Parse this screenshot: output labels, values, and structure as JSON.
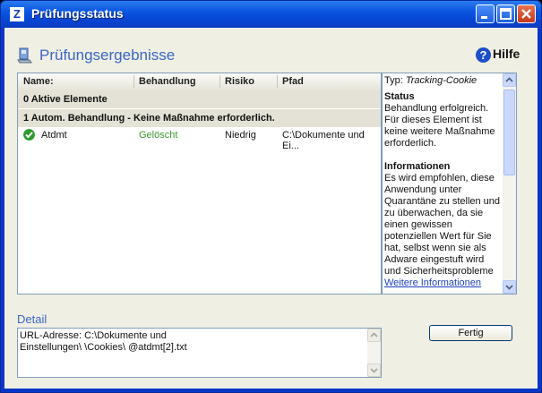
{
  "window": {
    "title": "Prüfungsstatus"
  },
  "header": {
    "title": "Prüfungsergebnisse",
    "help_label": "Hilfe"
  },
  "list": {
    "columns": [
      "Name:",
      "Behandlung",
      "Risiko",
      "Pfad"
    ],
    "groups": [
      {
        "label": "0 Aktive Elemente"
      },
      {
        "label": "1 Autom. Behandlung - Keine Maßnahme erforderlich."
      }
    ],
    "rows": [
      {
        "name": "Atdmt",
        "treatment": "Gelöscht",
        "risk": "Niedrig",
        "path": "C:\\Dokumente und Ei..."
      }
    ],
    "treatment_color": "#3a9a2a"
  },
  "info": {
    "type_label": "Typ:",
    "type_value": "Tracking-Cookie",
    "status_heading": "Status",
    "status_text": "Behandlung erfolgreich. Für dieses Element ist keine weitere Maßnahme erforderlich.",
    "info_heading": "Informationen",
    "info_text": "Es wird empfohlen, diese Anwendung unter Quarantäne zu stellen und zu überwachen, da sie einen gewissen potenziellen Wert für Sie hat, selbst wenn sie als Adware eingestuft wird und Sicherheitsprobleme",
    "link": "Weitere Informationen"
  },
  "detail": {
    "label": "Detail",
    "text": "URL-Adresse: C:\\Dokumente und\nEinstellungen\\  \\Cookies\\  @atdmt[2].txt"
  },
  "buttons": {
    "finish": "Fertig"
  },
  "colors": {
    "accent": "#3a66c4",
    "titlebar": "#0a55e0"
  }
}
